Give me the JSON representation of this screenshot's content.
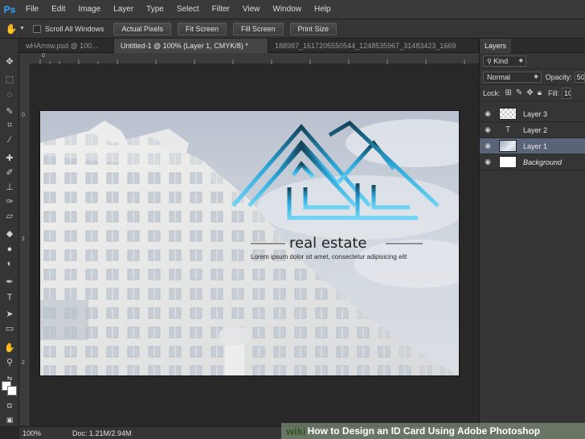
{
  "app": {
    "logo": "Ps"
  },
  "menu": [
    "File",
    "Edit",
    "Image",
    "Layer",
    "Type",
    "Select",
    "Filter",
    "View",
    "Window",
    "Help"
  ],
  "options": {
    "tool_icon": "hand-icon",
    "scroll_all": "Scroll All Windows",
    "buttons": [
      "Actual Pixels",
      "Fit Screen",
      "Fill Screen",
      "Print Size"
    ]
  },
  "tabs": [
    {
      "label": "wHArrow.psd @ 100...",
      "active": false
    },
    {
      "label": "Untitled-1 @ 100% (Layer 1, CMYK/8) *",
      "active": true
    },
    {
      "label": "188987_1617205550544_1248535967_31483423_1669",
      "active": false
    }
  ],
  "rulers": {
    "h_zero": "0",
    "v_zero": "0",
    "v_one": "1",
    "v_two": "2"
  },
  "canvas": {
    "logo_title": "real estate",
    "logo_tagline": "Lorem ipsum dolor sit amet, consectetur adipisicing elit"
  },
  "status": {
    "zoom": "100%",
    "doc": "Doc: 1.21M/2.94M"
  },
  "layers_panel": {
    "title": "Layers",
    "filter": "Kind",
    "blend": "Normal",
    "opacity_label": "Opacity:",
    "opacity_value": "50",
    "lock_label": "Lock:",
    "fill_label": "Fill:",
    "fill_value": "10",
    "layers": [
      {
        "name": "Layer 3",
        "thumb": "trans",
        "italic": false,
        "selected": false
      },
      {
        "name": "Layer 2",
        "thumb": "text",
        "italic": false,
        "selected": false
      },
      {
        "name": "Layer 1",
        "thumb": "photo",
        "italic": false,
        "selected": true
      },
      {
        "name": "Background",
        "thumb": "white",
        "italic": true,
        "selected": false
      }
    ]
  },
  "watermark": {
    "wiki": "wiki",
    "text": "How to Design an ID Card Using Adobe Photoshop"
  },
  "colors": {
    "accent": "#30a8ff",
    "logo_blue": "#2ba6d8",
    "selected_layer": "#5a6478"
  }
}
